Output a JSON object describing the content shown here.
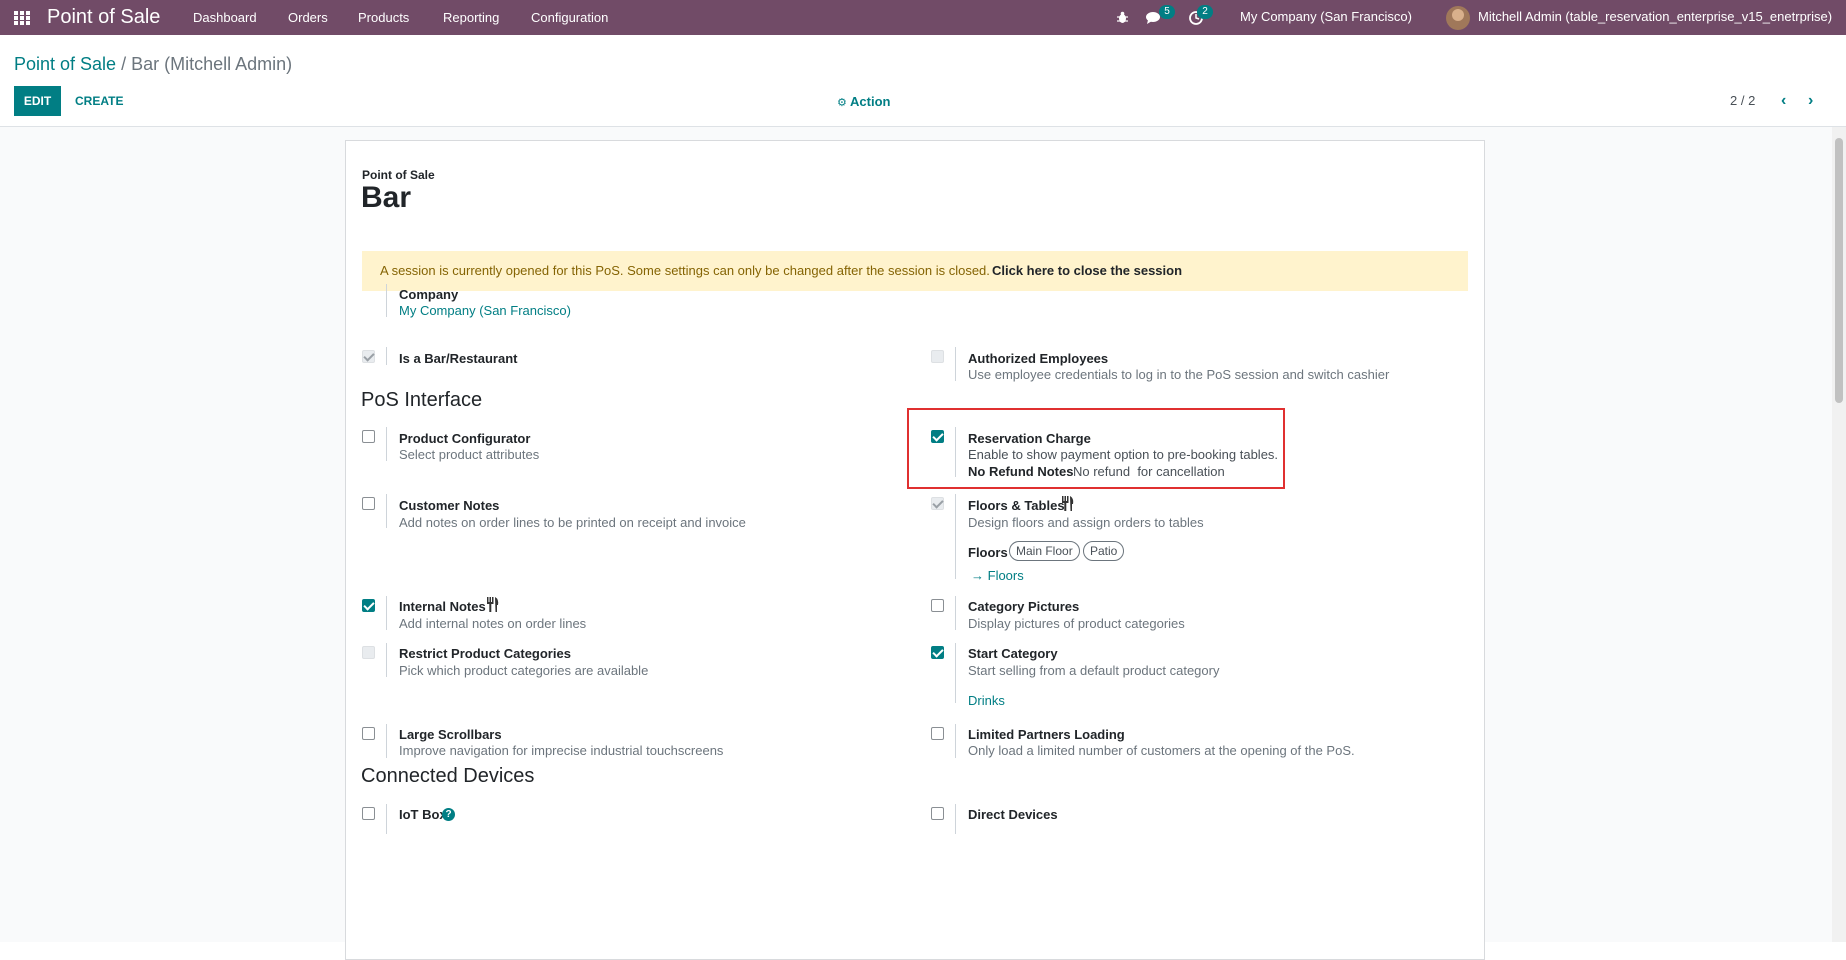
{
  "navbar": {
    "app_title": "Point of Sale",
    "menus": [
      "Dashboard",
      "Orders",
      "Products",
      "Reporting",
      "Configuration"
    ],
    "messages_count": "5",
    "activities_count": "2",
    "company": "My Company (San Francisco)",
    "user": "Mitchell Admin (table_reservation_enterprise_v15_enetrprise)"
  },
  "breadcrumb": {
    "parent": "Point of Sale",
    "separator": "/",
    "current": "Bar (Mitchell Admin)"
  },
  "toolbar": {
    "edit_label": "EDIT",
    "create_label": "CREATE",
    "action_label": "Action",
    "pager": "2 / 2"
  },
  "form": {
    "subtitle": "Point of Sale",
    "name": "Bar",
    "alert_text": "A session is currently opened for this PoS. Some settings can only be changed after the session is closed.",
    "alert_link": "Click here to close the session",
    "company_label": "Company",
    "company_value": "My Company (San Francisco)",
    "sections": {
      "pos_interface": "PoS Interface",
      "connected_devices": "Connected Devices"
    },
    "settings": {
      "is_bar": {
        "label": "Is a Bar/Restaurant",
        "checked": true
      },
      "authorized_employees": {
        "label": "Authorized Employees",
        "desc": "Use employee credentials to log in to the PoS session and switch cashier",
        "checked": false
      },
      "product_configurator": {
        "label": "Product Configurator",
        "desc": "Select product attributes",
        "checked": false
      },
      "reservation_charge": {
        "label": "Reservation Charge",
        "desc": "Enable to show payment option to pre-booking tables.",
        "notes_label": "No Refund Notes",
        "notes_value": "No refund  for cancellation",
        "checked": true
      },
      "customer_notes": {
        "label": "Customer Notes",
        "desc": "Add notes on order lines to be printed on receipt and invoice",
        "checked": false
      },
      "floors_tables": {
        "label": "Floors & Tables",
        "desc": "Design floors and assign orders to tables",
        "floors_label": "Floors",
        "floors": [
          "Main Floor",
          "Patio"
        ],
        "floors_link": "Floors",
        "checked": true
      },
      "internal_notes": {
        "label": "Internal Notes",
        "desc": "Add internal notes on order lines",
        "checked": true
      },
      "category_pictures": {
        "label": "Category Pictures",
        "desc": "Display pictures of product categories",
        "checked": false
      },
      "restrict_categories": {
        "label": "Restrict Product Categories",
        "desc": "Pick which product categories are available",
        "checked": false
      },
      "start_category": {
        "label": "Start Category",
        "desc": "Start selling from a default product category",
        "value": "Drinks",
        "checked": true
      },
      "large_scrollbars": {
        "label": "Large Scrollbars",
        "desc": "Improve navigation for imprecise industrial touchscreens",
        "checked": false
      },
      "limited_partners": {
        "label": "Limited Partners Loading",
        "desc": "Only load a limited number of customers at the opening of the PoS.",
        "checked": false
      },
      "iot_box": {
        "label": "IoT Box",
        "checked": false
      },
      "direct_devices": {
        "label": "Direct Devices",
        "checked": false
      }
    }
  },
  "colors": {
    "navbar": "#714B67",
    "accent": "#017E84",
    "alert_bg": "#fff3cd",
    "highlight": "#e03030"
  }
}
